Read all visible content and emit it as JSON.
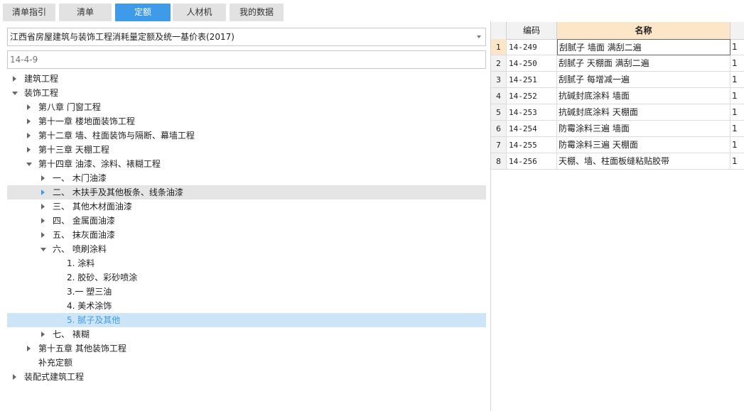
{
  "tabs": [
    {
      "label": "清单指引",
      "active": false
    },
    {
      "label": "清单",
      "active": false
    },
    {
      "label": "定额",
      "active": true
    },
    {
      "label": "人材机",
      "active": false
    },
    {
      "label": "我的数据",
      "active": false
    }
  ],
  "library": {
    "selected": "江西省房屋建筑与装饰工程消耗量定额及统一基价表(2017)"
  },
  "search": {
    "placeholder": "14-4-9"
  },
  "tree": [
    {
      "label": "建筑工程",
      "state": "collapsed"
    },
    {
      "label": "装饰工程",
      "state": "expanded"
    },
    {
      "label": "第八章 门窗工程",
      "state": "collapsed"
    },
    {
      "label": "第十一章 楼地面装饰工程",
      "state": "collapsed"
    },
    {
      "label": "第十二章 墙、柱面装饰与隔断、幕墙工程",
      "state": "collapsed"
    },
    {
      "label": "第十三章 天棚工程",
      "state": "collapsed"
    },
    {
      "label": "第十四章 油漆、涂料、裱糊工程",
      "state": "expanded"
    },
    {
      "label": "一、  木门油漆",
      "state": "collapsed"
    },
    {
      "label": "二、  木扶手及其他板条、线条油漆",
      "state": "collapsed",
      "hover": true
    },
    {
      "label": "三、  其他木材面油漆",
      "state": "collapsed"
    },
    {
      "label": "四、  金属面油漆",
      "state": "collapsed"
    },
    {
      "label": "五、  抹灰面油漆",
      "state": "collapsed"
    },
    {
      "label": "六、  喷刷涂料",
      "state": "expanded"
    },
    {
      "label": "1. 涂料",
      "state": "leaf"
    },
    {
      "label": "2. 胶砂、彩砂喷涂",
      "state": "leaf"
    },
    {
      "label": "3.一 塑三油",
      "state": "leaf"
    },
    {
      "label": "4. 美术涂饰",
      "state": "leaf"
    },
    {
      "label": "5. 腻子及其他",
      "state": "leaf",
      "selected": true
    },
    {
      "label": "七、  裱糊",
      "state": "collapsed"
    },
    {
      "label": "第十五章 其他装饰工程",
      "state": "collapsed"
    },
    {
      "label": "补充定额",
      "state": "leaf"
    },
    {
      "label": "装配式建筑工程",
      "state": "collapsed"
    }
  ],
  "grid": {
    "headers": {
      "code": "编码",
      "name": "名称"
    },
    "rows": [
      {
        "no": "1",
        "code": "14-249",
        "name": "刮腻子 墙面 满刮二遍",
        "extra": "1"
      },
      {
        "no": "2",
        "code": "14-250",
        "name": "刮腻子 天棚面 满刮二遍",
        "extra": "1"
      },
      {
        "no": "3",
        "code": "14-251",
        "name": "刮腻子 每增减一遍",
        "extra": "1"
      },
      {
        "no": "4",
        "code": "14-252",
        "name": "抗碱封底涂料 墙面",
        "extra": "1"
      },
      {
        "no": "5",
        "code": "14-253",
        "name": "抗碱封底涂料 天棚面",
        "extra": "1"
      },
      {
        "no": "6",
        "code": "14-254",
        "name": "防霉涂料三遍 墙面",
        "extra": "1"
      },
      {
        "no": "7",
        "code": "14-255",
        "name": "防霉涂料三遍 天棚面",
        "extra": "1"
      },
      {
        "no": "8",
        "code": "14-256",
        "name": "天棚、墙、柱面板缝粘贴胶带",
        "extra": "1"
      }
    ]
  },
  "colors": {
    "accent": "#3d9be9",
    "selected_bg": "#cde6f7",
    "header_highlight": "#fde6c8"
  }
}
